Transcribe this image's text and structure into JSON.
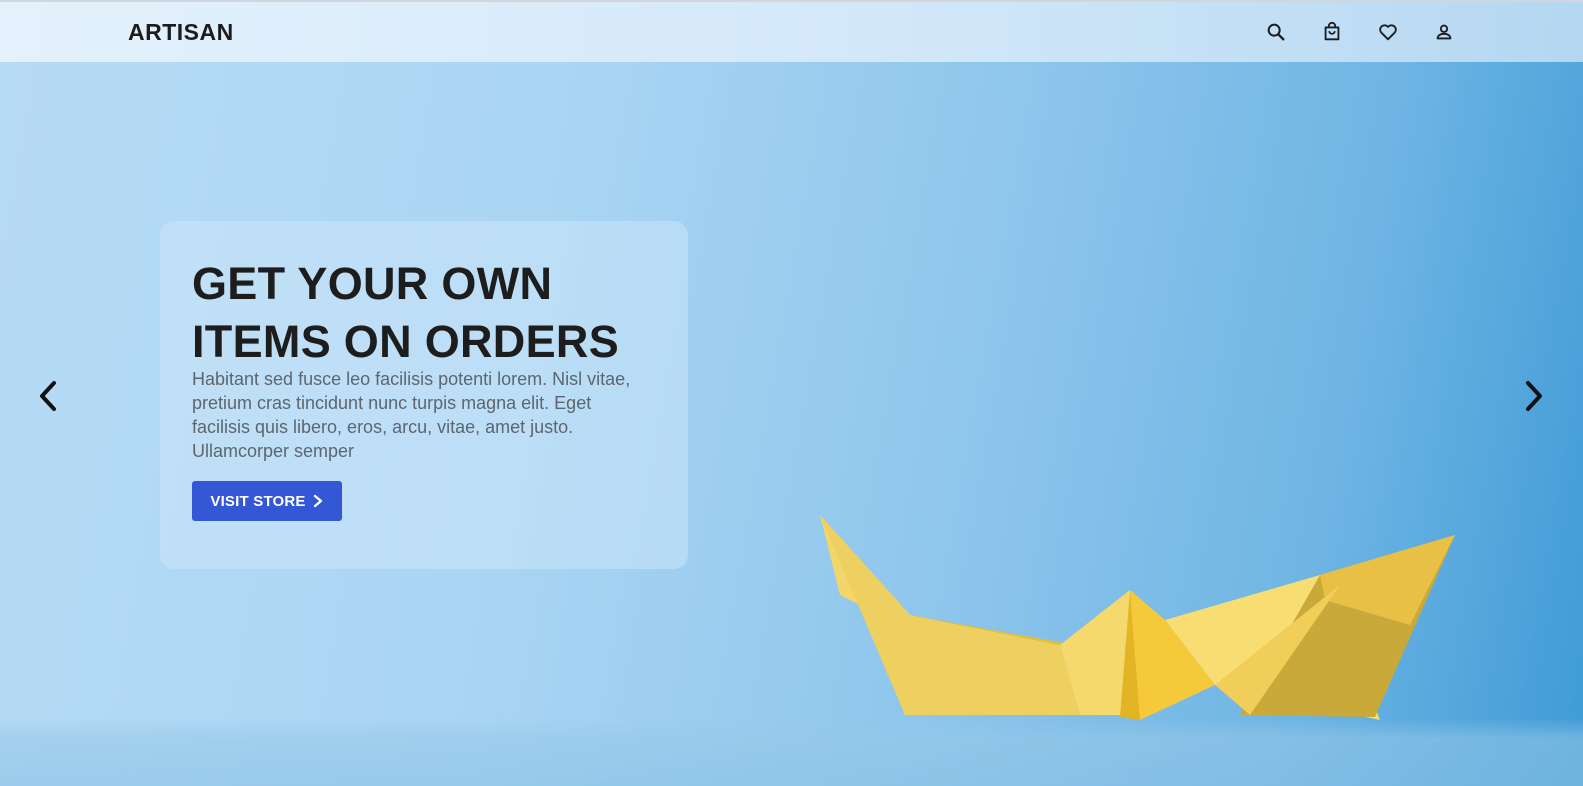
{
  "header": {
    "logo": "ARTISAN",
    "icons": [
      "search-icon",
      "shopping-bag-icon",
      "heart-icon",
      "user-icon"
    ]
  },
  "hero": {
    "title": "GET YOUR OWN ITEMS ON ORDERS",
    "description": "Habitant sed fusce leo facilisis potenti lorem. Nisl vitae, pretium cras tincidunt nunc turpis magna elit. Eget facilisis quis libero, eros, arcu, vitae, amet justo. Ullamcorper semper",
    "button_label": "VISIT STORE",
    "button_color": "#3457d5",
    "image": "paper-boat"
  },
  "carousel": {
    "prev_icon": "chevron-left-icon",
    "next_icon": "chevron-right-icon"
  },
  "colors": {
    "background": "#a9d5f3",
    "boat": "#f5d769"
  }
}
